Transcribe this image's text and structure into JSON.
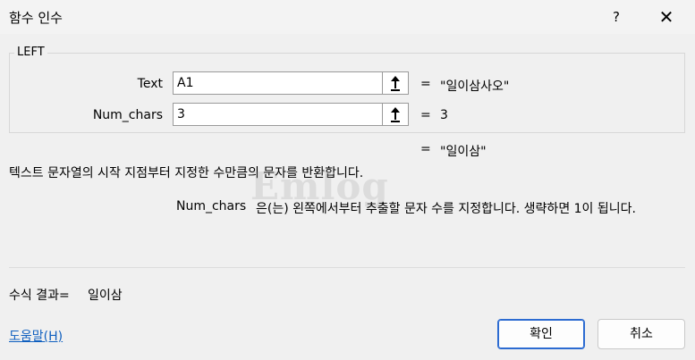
{
  "window": {
    "title": "함수 인수"
  },
  "titlebar": {
    "help_label": "?",
    "close_label": "✕"
  },
  "function_name": "LEFT",
  "arguments": [
    {
      "label": "Text",
      "value": "A1",
      "result": "\"일이삼사오\""
    },
    {
      "label": "Num_chars",
      "value": "3",
      "result": "3"
    }
  ],
  "equals_sign": "=",
  "function_result": "\"일이삼\"",
  "description": "텍스트 문자열의 시작 지점부터 지정한 수만큼의 문자를 반환합니다.",
  "watermark": "Emlog",
  "argument_help": {
    "name": "Num_chars",
    "text": "은(는) 왼쪽에서부터 추출할 문자 수를 지정합니다. 생략하면 1이 됩니다."
  },
  "formula_result": {
    "label": "수식 결과=",
    "value": "일이삼"
  },
  "help_link": "도움말(H)",
  "buttons": {
    "ok": "확인",
    "cancel": "취소"
  }
}
